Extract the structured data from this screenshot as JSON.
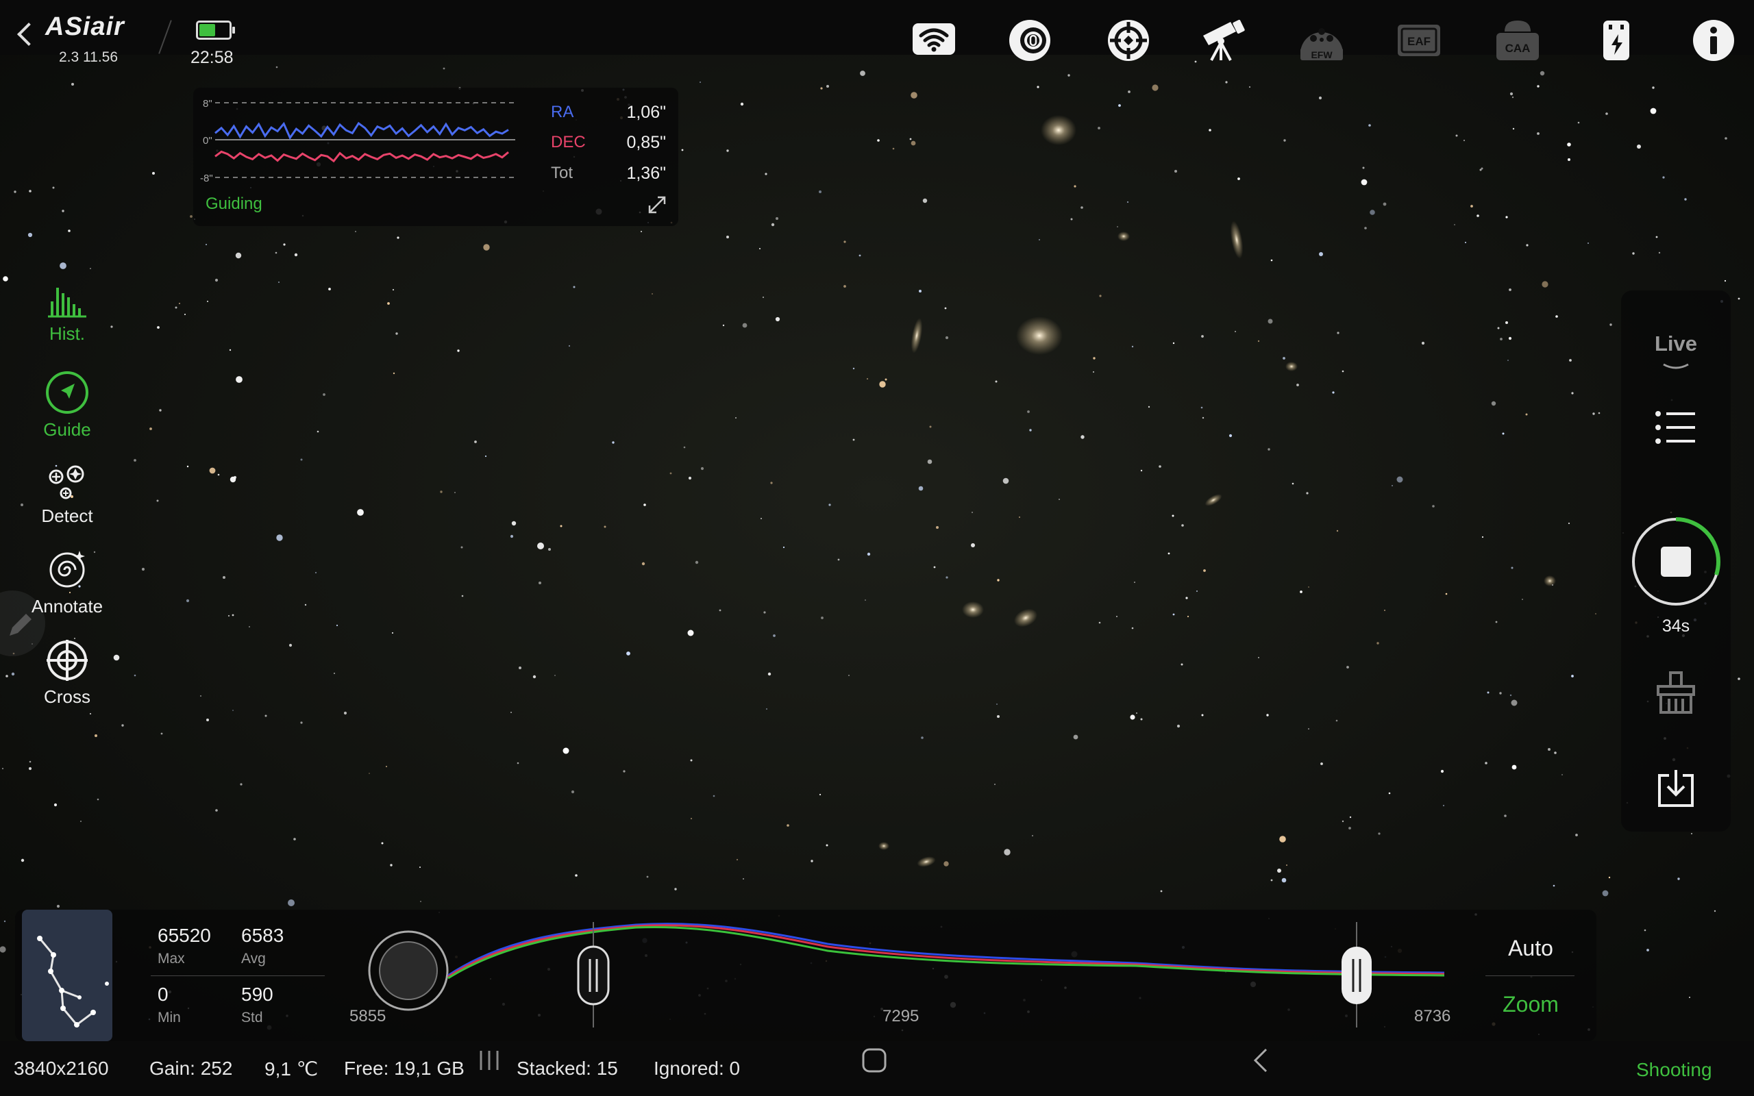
{
  "app": {
    "brand": "ASiair",
    "version": "2.3 11.56",
    "clock": "22:58",
    "battery_level": 0.55
  },
  "colors": {
    "accent": "#3fbf3f",
    "ra": "#4a6cf0",
    "dec": "#e8436a"
  },
  "top_icons": [
    "wifi-icon",
    "camera-icon",
    "guide-target-icon",
    "telescope-icon",
    "efw-icon",
    "eaf-icon",
    "caa-icon",
    "usb-power-icon",
    "info-icon"
  ],
  "top_icon_text": {
    "efw": "EFW",
    "eaf": "EAF",
    "caa": "CAA"
  },
  "guiding": {
    "scale_top": "8\"",
    "scale_mid": "0\"",
    "scale_bot": "-8\"",
    "ra_label": "RA",
    "ra_value": "1,06\"",
    "dec_label": "DEC",
    "dec_value": "0,85\"",
    "tot_label": "Tot",
    "tot_value": "1,36\"",
    "status": "Guiding",
    "ra_series": [
      1.5,
      2.6,
      1.1,
      3.0,
      0.7,
      2.9,
      1.6,
      3.4,
      0.9,
      2.7,
      1.9,
      3.5,
      0.5,
      2.4,
      1.4,
      3.1,
      2.0,
      0.8,
      2.8,
      1.2,
      3.3,
      2.1,
      1.5,
      3.6,
      2.6,
      1.0,
      2.9,
      2.3,
      3.1,
      1.4,
      2.5,
      0.9,
      2.0,
      3.2,
      1.7,
      2.9,
      1.3,
      3.4,
      1.2,
      2.6,
      2.1,
      2.8,
      1.5,
      2.3,
      0.9,
      1.8,
      1.4,
      2.2
    ],
    "dec_series": [
      -3.5,
      -2.5,
      -3.0,
      -3.9,
      -2.8,
      -3.6,
      -4.1,
      -3.0,
      -3.8,
      -3.3,
      -4.4,
      -3.1,
      -3.6,
      -4.0,
      -2.9,
      -3.7,
      -4.3,
      -3.2,
      -3.5,
      -4.5,
      -2.8,
      -3.9,
      -3.4,
      -4.2,
      -3.0,
      -3.6,
      -4.1,
      -3.2,
      -2.9,
      -3.8,
      -3.3,
      -4.0,
      -3.1,
      -3.5,
      -4.2,
      -3.0,
      -3.7,
      -3.4,
      -3.9,
      -3.2,
      -3.6,
      -4.0,
      -3.1,
      -3.8,
      -3.5,
      -3.0,
      -3.7,
      -2.6
    ]
  },
  "tools": [
    {
      "label": "Hist.",
      "icon": "histogram-icon",
      "active": true
    },
    {
      "label": "Guide",
      "icon": "guide-icon",
      "active": true
    },
    {
      "label": "Detect",
      "icon": "detect-icon",
      "active": false
    },
    {
      "label": "Annotate",
      "icon": "annotate-icon",
      "active": false
    },
    {
      "label": "Cross",
      "icon": "crosshair-icon",
      "active": false
    }
  ],
  "right_panel": {
    "mode": "Live",
    "timer": "34s",
    "progress": 0.3
  },
  "histogram": {
    "max_value": "65520",
    "max_label": "Max",
    "avg_value": "6583",
    "avg_label": "Avg",
    "min_value": "0",
    "min_label": "Min",
    "std_value": "590",
    "std_label": "Std",
    "axis_left": "5855",
    "axis_mid": "7295",
    "axis_right": "8736",
    "auto_label": "Auto",
    "zoom_label": "Zoom"
  },
  "statusbar": {
    "resolution": "3840x2160",
    "gain": "Gain: 252",
    "temperature": "9,1 ℃",
    "free": "Free: 19,1 GB",
    "stacked": "Stacked: 15",
    "ignored": "Ignored: 0",
    "state": "Shooting"
  }
}
